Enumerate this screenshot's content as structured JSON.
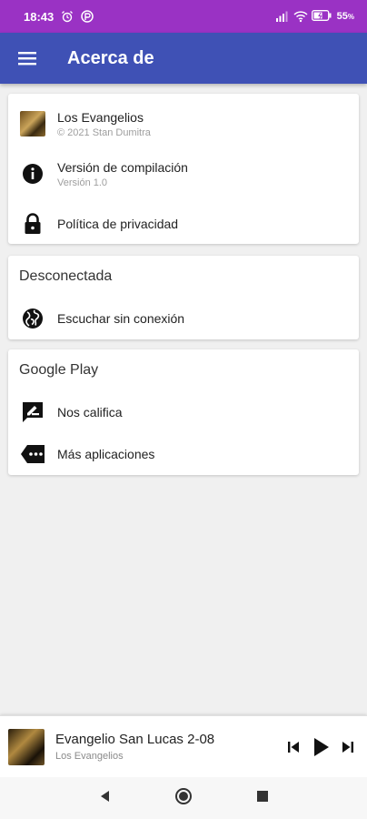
{
  "status_bar": {
    "time": "18:43",
    "battery": "55"
  },
  "app_bar": {
    "title": "Acerca de"
  },
  "about_card": {
    "app_name": "Los Evangelios",
    "copyright": "© 2021 Stan Dumitra",
    "build_label": "Versión de compilación",
    "build_value": "Versión 1.0",
    "privacy_label": "Política de privacidad"
  },
  "offline_card": {
    "header": "Desconectada",
    "listen_offline": "Escuchar sin conexión"
  },
  "play_card": {
    "header": "Google Play",
    "rate_us": "Nos califica",
    "more_apps": "Más aplicaciones"
  },
  "player": {
    "track_title": "Evangelio San Lucas 2-08",
    "album": "Los Evangelios"
  },
  "colors": {
    "status_bar": "#9a32c4",
    "app_bar": "#3f51b5",
    "background": "#f0f0f0"
  }
}
